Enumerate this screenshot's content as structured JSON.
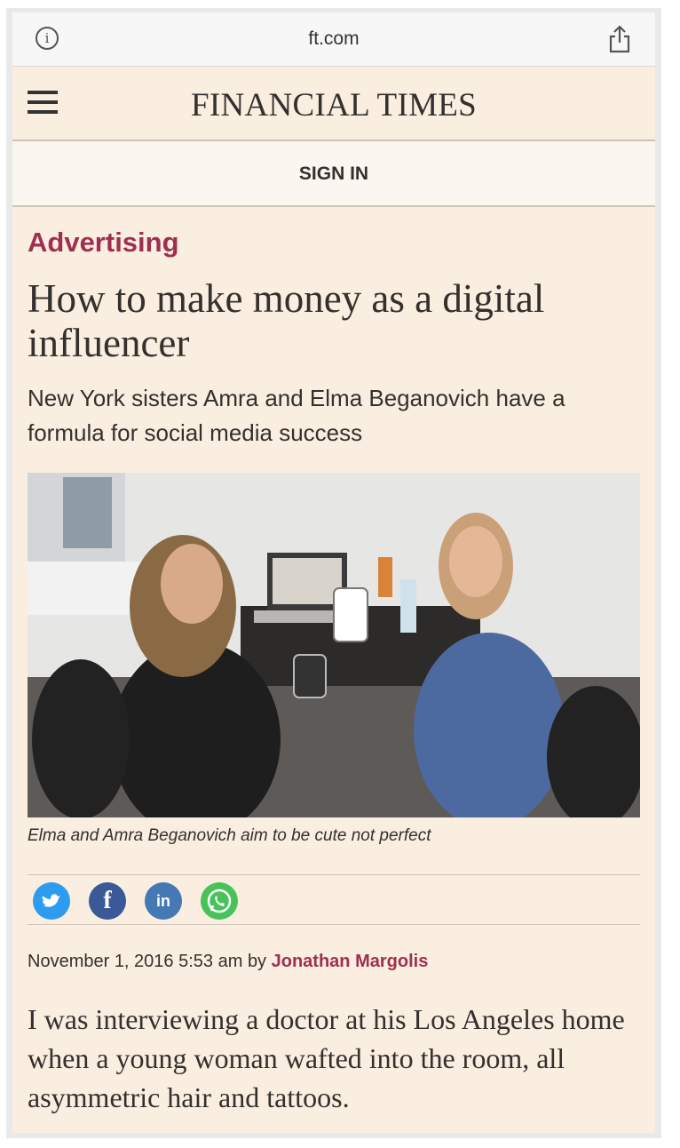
{
  "browser": {
    "url": "ft.com",
    "info_icon": "info-icon",
    "share_icon": "share-icon"
  },
  "masthead": {
    "menu_icon": "hamburger-menu-icon",
    "logo": "FINANCIAL TIMES",
    "sign_in": "SIGN IN"
  },
  "article": {
    "topic": "Advertising",
    "headline": "How to make money as a digital influencer",
    "standfirst": "New York sisters Amra and Elma Beganovich have a formula for social media success",
    "image_caption": "Elma and Amra Beganovich aim to be cute not perfect",
    "share": [
      "twitter-icon",
      "facebook-icon",
      "linkedin-icon",
      "whatsapp-icon"
    ],
    "date": "November 1, 2016 5:53 am",
    "by": "by",
    "author": "Jonathan Margolis",
    "body": "I was interviewing a doctor at his Los Angeles home when a young woman wafted into the room, all asymmetric hair and tattoos."
  },
  "colors": {
    "page_bg": "#faeee0",
    "accent": "#9e2f50",
    "text": "#33302e"
  }
}
